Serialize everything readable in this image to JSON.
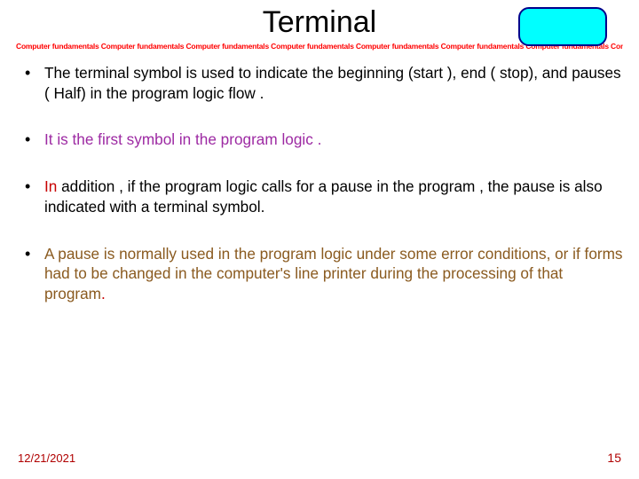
{
  "title": "Terminal",
  "tape_unit": "Computer fundamentals ",
  "tape_repeat": 8,
  "bullets": [
    {
      "class": "txt-black",
      "prefix": "",
      "text": "The terminal symbol is used to indicate the beginning (start ), end ( stop), and pauses ( Half) in the program logic flow ."
    },
    {
      "class": "txt-purple",
      "prefix": "",
      "text": " It is the first symbol in the program logic ."
    },
    {
      "class": "",
      "prefix": "in_addition",
      "text": " addition , if the program logic calls for a pause in the program , the pause is also indicated with a terminal symbol."
    },
    {
      "class": "txt-brown",
      "prefix": "",
      "text": "A pause is normally used in the program logic under some error conditions, or if forms had to be changed in the computer's line printer during the processing of that program",
      "trailing_period": true
    }
  ],
  "in_word": "In",
  "footer": {
    "date": "12/21/2021",
    "page": "15"
  }
}
